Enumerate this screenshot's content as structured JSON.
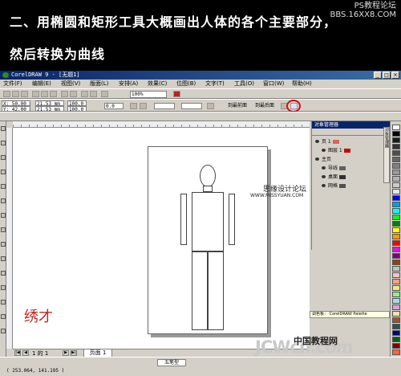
{
  "banner": {
    "line1": "二、用椭圆和矩形工具大概画出人体的各个主要部分，",
    "line2": "然后转换为曲线",
    "site_logo_line1": "PS教程论坛",
    "site_logo_line2": "BBS.16XX8.COM"
  },
  "app": {
    "title": "CorelDRAW 9 - [无题1]",
    "menu": [
      "文件(F)",
      "编辑(E)",
      "视图(V)",
      "版面(L)",
      "安排(A)",
      "效果(C)",
      "位图(B)",
      "文字(T)",
      "工具(O)",
      "窗口(W)",
      "帮助(H)"
    ],
    "toolbar": {
      "zoom": "100%",
      "x_pos": "X: 50.00 mm",
      "y_pos": "Y: 42.00 mm",
      "width": "21.53 mm",
      "height": "21.53 mm",
      "scale_x": "100.0",
      "scale_y": "100.0",
      "rotation": "0.0",
      "btn_to_front": "到最前面",
      "btn_to_back": "到最后面"
    },
    "page_nav": {
      "page_info": "1 的 1",
      "page_tab": "页面 1"
    },
    "status": {
      "coords": "( 253.064, 141.195 )",
      "box_label": "五笔型"
    },
    "docker": {
      "title": "对象管理器",
      "layers": [
        {
          "label": "页 1",
          "color": "#e06060"
        },
        {
          "label": "图层 1",
          "color": "#d00000"
        },
        {
          "label": "主页",
          "color": ""
        },
        {
          "label": "导线",
          "color": "#606060"
        },
        {
          "label": "桌面",
          "color": "#303030"
        },
        {
          "label": "网格",
          "color": "#505050"
        }
      ],
      "tab_label": "对象管理器"
    },
    "palette_label": "调色板： CorelDRAW Palette"
  },
  "overlays": {
    "forum_cn": "思缘设计论坛",
    "forum_url": "WWW.MISSYUAN.COM",
    "stamp_text": "绣才",
    "brand_cn": "中国教程网",
    "brand_big": "JCWcn.com"
  },
  "colors": {
    "palette": [
      "#ffffff",
      "#000000",
      "#1a1a1a",
      "#333333",
      "#4d4d4d",
      "#666666",
      "#808080",
      "#999999",
      "#b3b3b3",
      "#cccccc",
      "#e6e6e6",
      "#0000ff",
      "#00a0e0",
      "#00ffff",
      "#00ff00",
      "#008000",
      "#ffff00",
      "#ff9900",
      "#ff0000",
      "#ff00ff",
      "#800080",
      "#8b4513",
      "#c0c0c0",
      "#ffc0cb",
      "#ffa07a",
      "#f0e68c",
      "#90ee90",
      "#add8e6",
      "#dda0dd",
      "#f5deb3",
      "#a0522d",
      "#2f4f4f",
      "#000080",
      "#006400",
      "#800000",
      "#ff6347"
    ]
  }
}
